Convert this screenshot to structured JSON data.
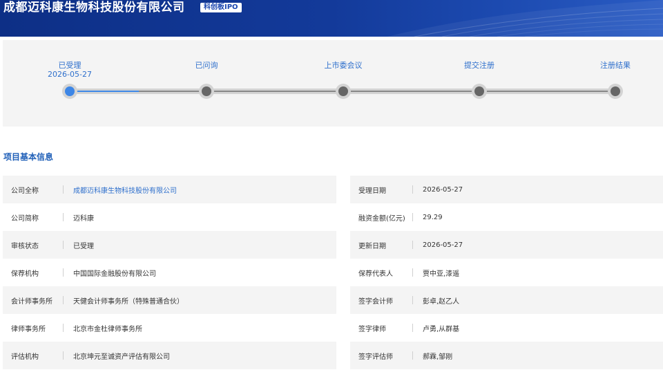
{
  "header": {
    "company_name": "成都迈科康生物科技股份有限公司",
    "board_badge": "科创板IPO"
  },
  "progress": {
    "steps": [
      {
        "label": "已受理",
        "date": "2026-05-27",
        "active": true
      },
      {
        "label": "已问询",
        "date": "",
        "active": false
      },
      {
        "label": "上市委会议",
        "date": "",
        "active": false
      },
      {
        "label": "提交注册",
        "date": "",
        "active": false
      },
      {
        "label": "注册结果",
        "date": "",
        "active": false
      }
    ]
  },
  "section": {
    "title": "项目基本信息"
  },
  "info": {
    "rows": [
      {
        "left_key": "公司全称",
        "left_val": "成都迈科康生物科技股份有限公司",
        "right_key": "受理日期",
        "right_val": "2026-05-27"
      },
      {
        "left_key": "公司简称",
        "left_val": "迈科康",
        "right_key": "融资金额(亿元)",
        "right_val": "29.29"
      },
      {
        "left_key": "审核状态",
        "left_val": "已受理",
        "right_key": "更新日期",
        "right_val": "2026-05-27"
      },
      {
        "left_key": "保荐机构",
        "left_val": "中国国际金融股份有限公司",
        "right_key": "保荐代表人",
        "right_val": "贾中亚,漆遥"
      },
      {
        "left_key": "会计师事务所",
        "left_val": "天健会计师事务所（特殊普通合伙）",
        "right_key": "签字会计师",
        "right_val": "彭卓,赵乙人"
      },
      {
        "left_key": "律师事务所",
        "left_val": "北京市金杜律师事务所",
        "right_key": "签字律师",
        "right_val": "卢勇,从群基"
      },
      {
        "left_key": "评估机构",
        "left_val": "北京坤元至诚资产评估有限公司",
        "right_key": "签字评估师",
        "right_val": "郝霖,邹刚"
      }
    ]
  }
}
